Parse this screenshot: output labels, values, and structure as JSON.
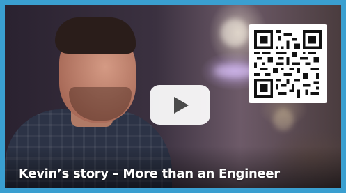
{
  "video": {
    "title": "Kevin’s story – More than an Engineer",
    "play_icon": "play-icon",
    "qr_icon": "qr-code-icon"
  },
  "colors": {
    "frame": "#3a9fd0",
    "play_button_bg": "#ffffff",
    "play_icon": "#4a4a4a",
    "title_text": "#ffffff"
  }
}
